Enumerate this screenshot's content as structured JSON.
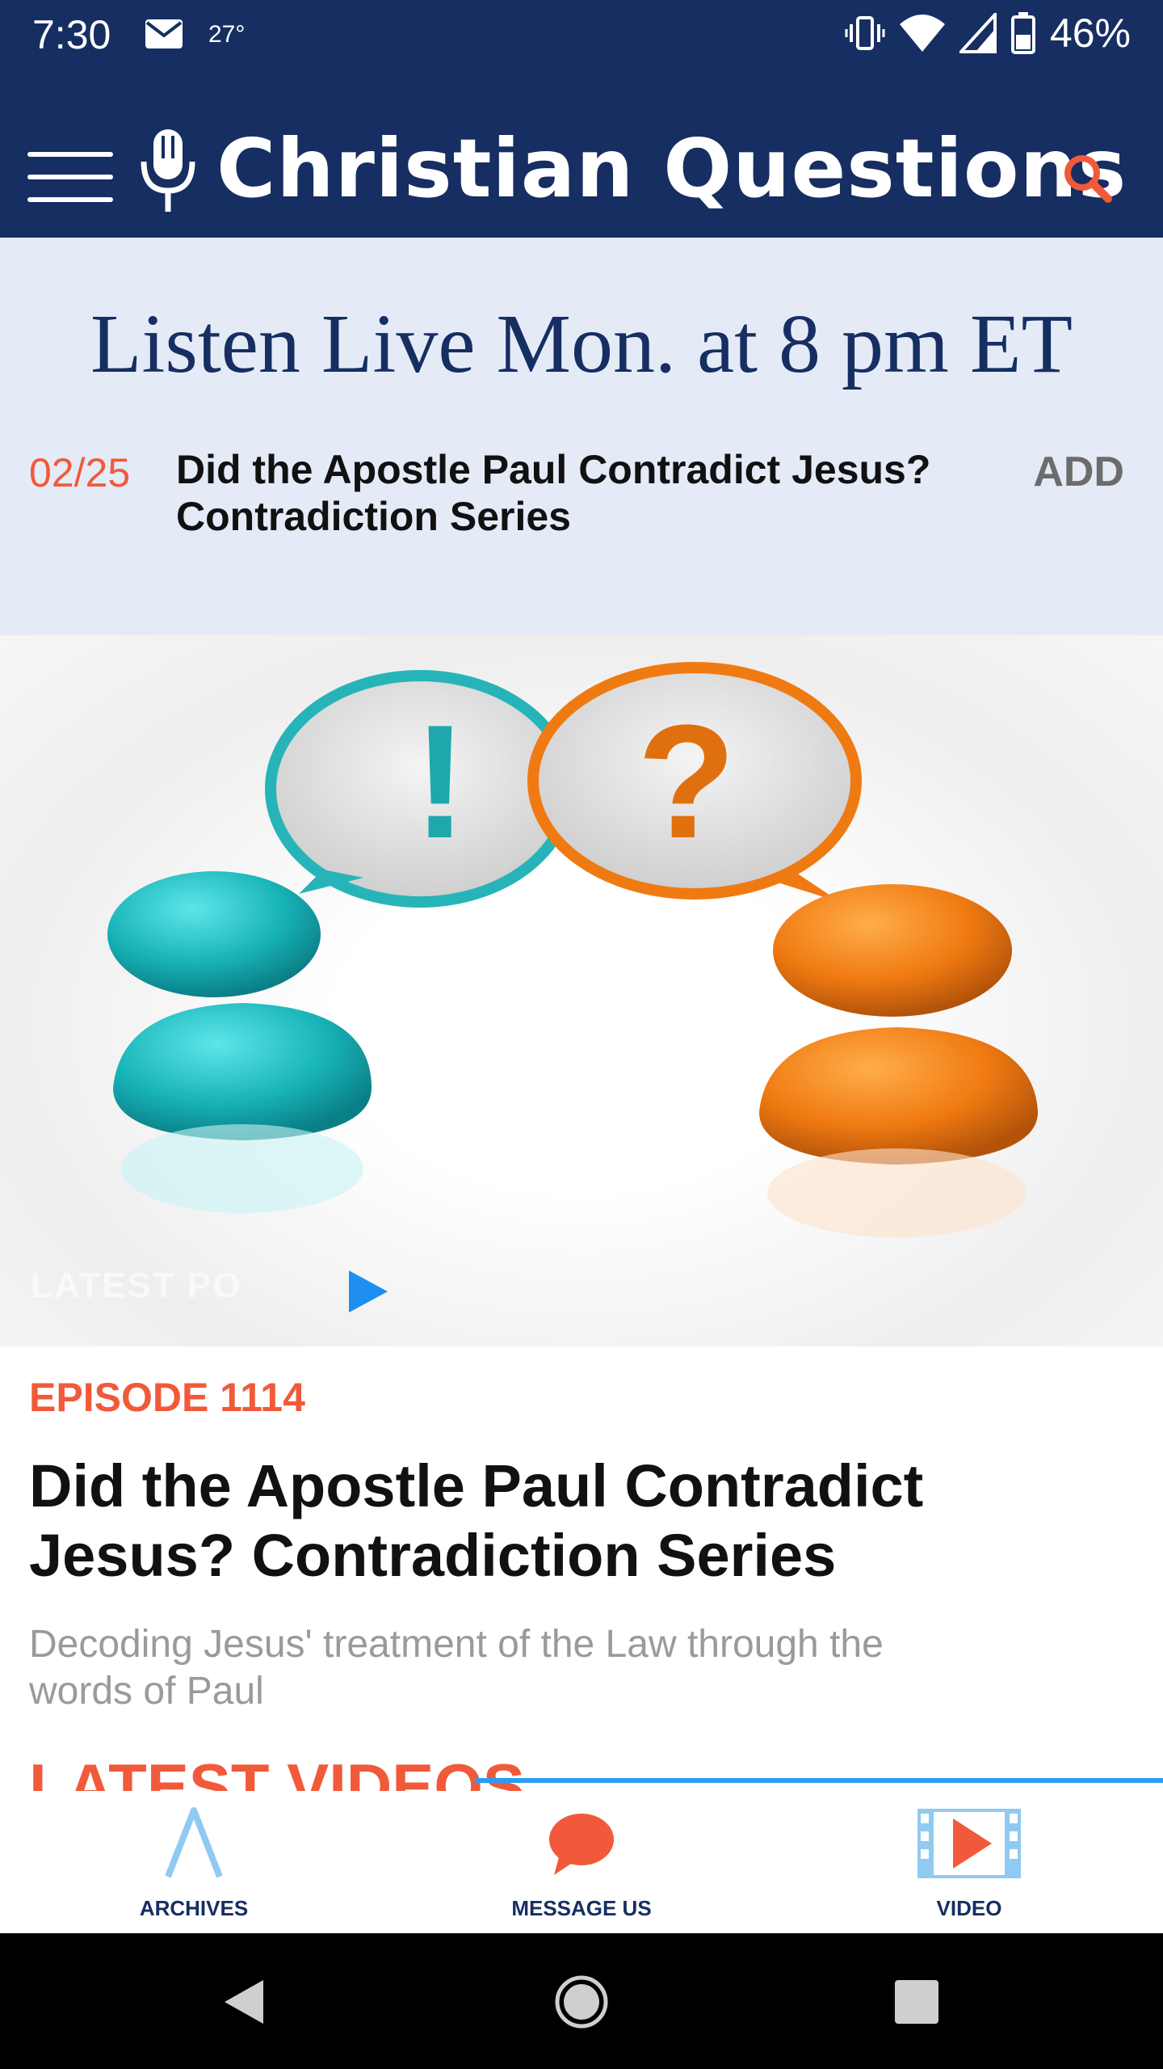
{
  "status_bar": {
    "time": "7:30",
    "temperature": "27°",
    "battery": "46%",
    "icons": [
      "mail-icon",
      "vibrate-icon",
      "wifi-icon",
      "signal-icon",
      "battery-icon"
    ]
  },
  "header": {
    "title": "Christian Questions",
    "menu_icon": "hamburger-menu-icon",
    "logo_icon": "microphone-icon",
    "search_icon": "search-icon"
  },
  "live": {
    "heading": "Listen Live Mon. at 8 pm ET",
    "date": "02/25",
    "title": "Did the Apostle Paul Contradict Jesus? Contradiction Series",
    "add_label": "ADD"
  },
  "hero": {
    "overlay_label": "LATEST PO",
    "play_icon": "play-icon"
  },
  "episode": {
    "label": "EPISODE 1114",
    "title": "Did the Apostle Paul Contradict Jesus? Contradiction Series",
    "description": "Decoding Jesus' treatment of the Law through the words of Paul"
  },
  "section": {
    "latest_videos": "LATEST VIDEOS"
  },
  "tabs": [
    {
      "label": "ARCHIVES",
      "icon": "archives-icon"
    },
    {
      "label": "MESSAGE US",
      "icon": "chat-bubble-icon"
    },
    {
      "label": "VIDEO",
      "icon": "video-film-icon"
    }
  ],
  "colors": {
    "navy": "#162e62",
    "accent": "#f05a3a",
    "light_band": "#e4ebf7",
    "blue": "#2b9df0"
  }
}
